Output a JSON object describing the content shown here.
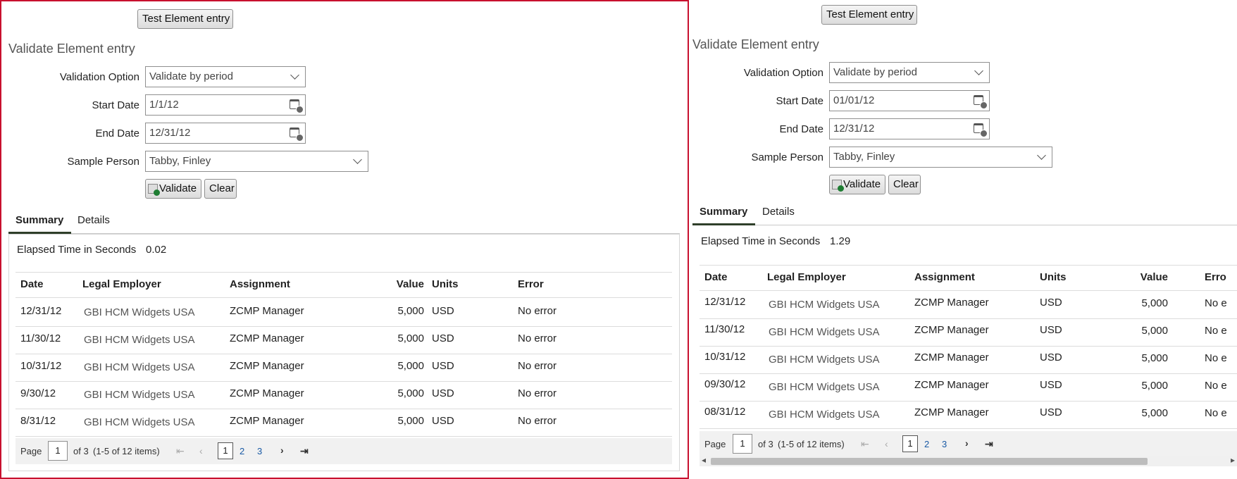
{
  "left": {
    "test_button": "Test Element entry",
    "section_title": "Validate Element entry",
    "form": {
      "validation_option_label": "Validation Option",
      "validation_option_value": "Validate by period",
      "start_date_label": "Start Date",
      "start_date_value": "1/1/12",
      "end_date_label": "End Date",
      "end_date_value": "12/31/12",
      "sample_person_label": "Sample Person",
      "sample_person_value": "Tabby, Finley"
    },
    "validate_button": "Validate",
    "clear_button": "Clear",
    "tabs": [
      "Summary",
      "Details"
    ],
    "elapsed_label": "Elapsed Time in Seconds",
    "elapsed_value": "0.02",
    "columns": [
      "Date",
      "Legal Employer",
      "Assignment",
      "Value",
      "Units",
      "Error"
    ],
    "rows": [
      [
        "12/31/12",
        "GBI HCM Widgets USA",
        "ZCMP Manager",
        "5,000",
        "USD",
        "No error"
      ],
      [
        "11/30/12",
        "GBI HCM Widgets USA",
        "ZCMP Manager",
        "5,000",
        "USD",
        "No error"
      ],
      [
        "10/31/12",
        "GBI HCM Widgets USA",
        "ZCMP Manager",
        "5,000",
        "USD",
        "No error"
      ],
      [
        "9/30/12",
        "GBI HCM Widgets USA",
        "ZCMP Manager",
        "5,000",
        "USD",
        "No error"
      ],
      [
        "8/31/12",
        "GBI HCM Widgets USA",
        "ZCMP Manager",
        "5,000",
        "USD",
        "No error"
      ]
    ],
    "pager": {
      "page_label": "Page",
      "current_page": "1",
      "of_text": "of 3",
      "items_text": "(1-5 of 12 items)",
      "pages": [
        "1",
        "2",
        "3"
      ]
    }
  },
  "right": {
    "test_button": "Test Element entry",
    "section_title": "Validate Element entry",
    "form": {
      "validation_option_label": "Validation Option",
      "validation_option_value": "Validate by period",
      "start_date_label": "Start Date",
      "start_date_value": "01/01/12",
      "end_date_label": "End Date",
      "end_date_value": "12/31/12",
      "sample_person_label": "Sample Person",
      "sample_person_value": "Tabby, Finley"
    },
    "validate_button": "Validate",
    "clear_button": "Clear",
    "tabs": [
      "Summary",
      "Details"
    ],
    "elapsed_label": "Elapsed Time in Seconds",
    "elapsed_value": "1.29",
    "columns": [
      "Date",
      "Legal Employer",
      "Assignment",
      "Units",
      "Value",
      "Erro"
    ],
    "rows": [
      [
        "12/31/12",
        "GBI HCM Widgets USA",
        "ZCMP Manager",
        "USD",
        "5,000",
        "No e"
      ],
      [
        "11/30/12",
        "GBI HCM Widgets USA",
        "ZCMP Manager",
        "USD",
        "5,000",
        "No e"
      ],
      [
        "10/31/12",
        "GBI HCM Widgets USA",
        "ZCMP Manager",
        "USD",
        "5,000",
        "No e"
      ],
      [
        "09/30/12",
        "GBI HCM Widgets USA",
        "ZCMP Manager",
        "USD",
        "5,000",
        "No e"
      ],
      [
        "08/31/12",
        "GBI HCM Widgets USA",
        "ZCMP Manager",
        "USD",
        "5,000",
        "No e"
      ]
    ],
    "pager": {
      "page_label": "Page",
      "current_page": "1",
      "of_text": "of 3",
      "items_text": "(1-5 of 12 items)",
      "pages": [
        "1",
        "2",
        "3"
      ]
    }
  },
  "icons": {
    "dropdown": "chevron-down-icon",
    "calendar": "calendar-icon",
    "validate": "validate-check-icon",
    "first": "first-page-icon",
    "prev": "previous-page-icon",
    "next": "next-page-icon",
    "last": "last-page-icon"
  },
  "colors": {
    "highlight_border": "#c8102e",
    "tab_underline": "#2f3f2a",
    "check_green": "#1e7d32"
  }
}
